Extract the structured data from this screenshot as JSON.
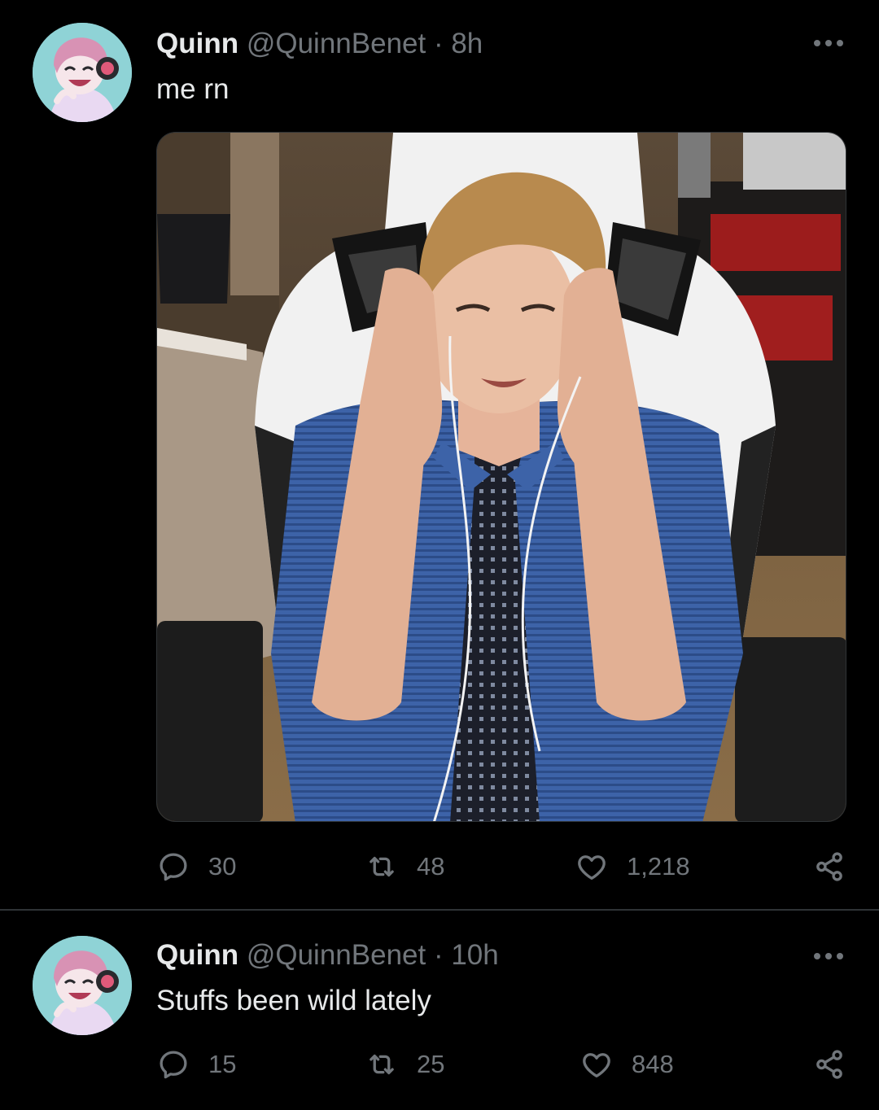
{
  "tweets": [
    {
      "author_name": "Quinn",
      "handle": "@QuinnBenet",
      "separator": "·",
      "time": "8h",
      "text": "me rn",
      "has_media": true,
      "media_alt": "Young man in a white gaming chair holding his head",
      "counts": {
        "replies": "30",
        "retweets": "48",
        "likes": "1,218"
      }
    },
    {
      "author_name": "Quinn",
      "handle": "@QuinnBenet",
      "separator": "·",
      "time": "10h",
      "text": "Stuffs been wild lately",
      "has_media": false,
      "counts": {
        "replies": "15",
        "retweets": "25",
        "likes": "848"
      }
    }
  ],
  "colors": {
    "background": "#000000",
    "text_primary": "#e7e9ea",
    "text_secondary": "#71767b",
    "divider": "#2f3336"
  },
  "icons": [
    "reply-icon",
    "retweet-icon",
    "like-icon",
    "share-icon",
    "more-icon"
  ]
}
